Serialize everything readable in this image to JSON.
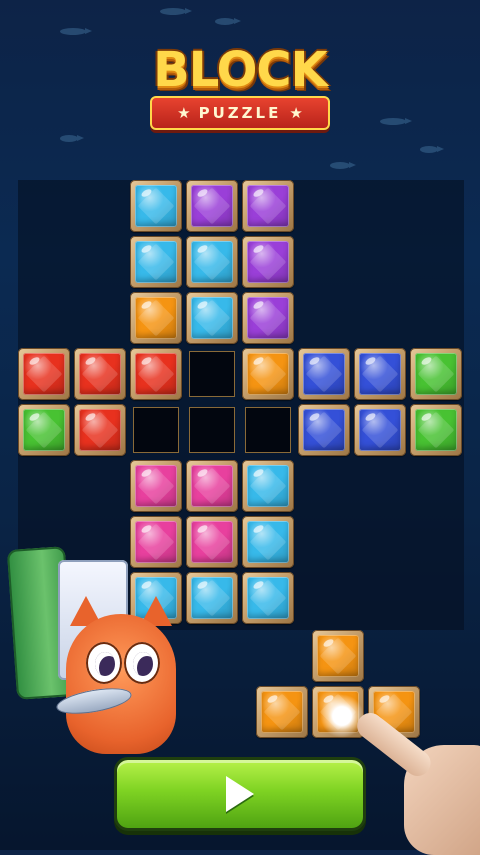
{
  "logo": {
    "title": "BLOCK",
    "subtitle": "PUZZLE",
    "star": "★"
  },
  "board": {
    "columns": 8,
    "rows": 8,
    "gems": [
      {
        "row": 0,
        "col": 2,
        "color": "cyan"
      },
      {
        "row": 0,
        "col": 3,
        "color": "purple"
      },
      {
        "row": 0,
        "col": 4,
        "color": "purple"
      },
      {
        "row": 1,
        "col": 2,
        "color": "cyan"
      },
      {
        "row": 1,
        "col": 3,
        "color": "cyan"
      },
      {
        "row": 1,
        "col": 4,
        "color": "purple"
      },
      {
        "row": 2,
        "col": 2,
        "color": "orange"
      },
      {
        "row": 2,
        "col": 3,
        "color": "cyan"
      },
      {
        "row": 2,
        "col": 4,
        "color": "purple"
      },
      {
        "row": 3,
        "col": 0,
        "color": "red"
      },
      {
        "row": 3,
        "col": 1,
        "color": "red"
      },
      {
        "row": 3,
        "col": 2,
        "color": "red"
      },
      {
        "row": 3,
        "col": 4,
        "color": "orange"
      },
      {
        "row": 3,
        "col": 5,
        "color": "blue"
      },
      {
        "row": 3,
        "col": 6,
        "color": "blue"
      },
      {
        "row": 3,
        "col": 7,
        "color": "green"
      },
      {
        "row": 4,
        "col": 0,
        "color": "green"
      },
      {
        "row": 4,
        "col": 1,
        "color": "red"
      },
      {
        "row": 4,
        "col": 5,
        "color": "blue"
      },
      {
        "row": 4,
        "col": 6,
        "color": "blue"
      },
      {
        "row": 4,
        "col": 7,
        "color": "green"
      },
      {
        "row": 5,
        "col": 2,
        "color": "pink"
      },
      {
        "row": 5,
        "col": 3,
        "color": "pink"
      },
      {
        "row": 5,
        "col": 4,
        "color": "cyan"
      },
      {
        "row": 6,
        "col": 2,
        "color": "pink"
      },
      {
        "row": 6,
        "col": 3,
        "color": "pink"
      },
      {
        "row": 6,
        "col": 4,
        "color": "cyan"
      },
      {
        "row": 7,
        "col": 2,
        "color": "cyan"
      },
      {
        "row": 7,
        "col": 3,
        "color": "cyan"
      },
      {
        "row": 7,
        "col": 4,
        "color": "cyan"
      }
    ],
    "empty_slots": [
      {
        "row": 3,
        "col": 3
      },
      {
        "row": 4,
        "col": 2
      },
      {
        "row": 4,
        "col": 3
      },
      {
        "row": 4,
        "col": 4
      }
    ]
  },
  "piece": {
    "shape": "T",
    "color": "orange",
    "cells": [
      {
        "row": 0,
        "col": 1
      },
      {
        "row": 1,
        "col": 0
      },
      {
        "row": 1,
        "col": 1
      },
      {
        "row": 1,
        "col": 2
      }
    ]
  },
  "play_button": {
    "icon": "play-icon",
    "color": "#7fd323"
  },
  "gem_colors": {
    "cyan": "#37b9ea",
    "purple": "#9a3fd8",
    "orange": "#f59412",
    "red": "#e8311e",
    "blue": "#3450d8",
    "green": "#48c232",
    "pink": "#e8409e"
  }
}
